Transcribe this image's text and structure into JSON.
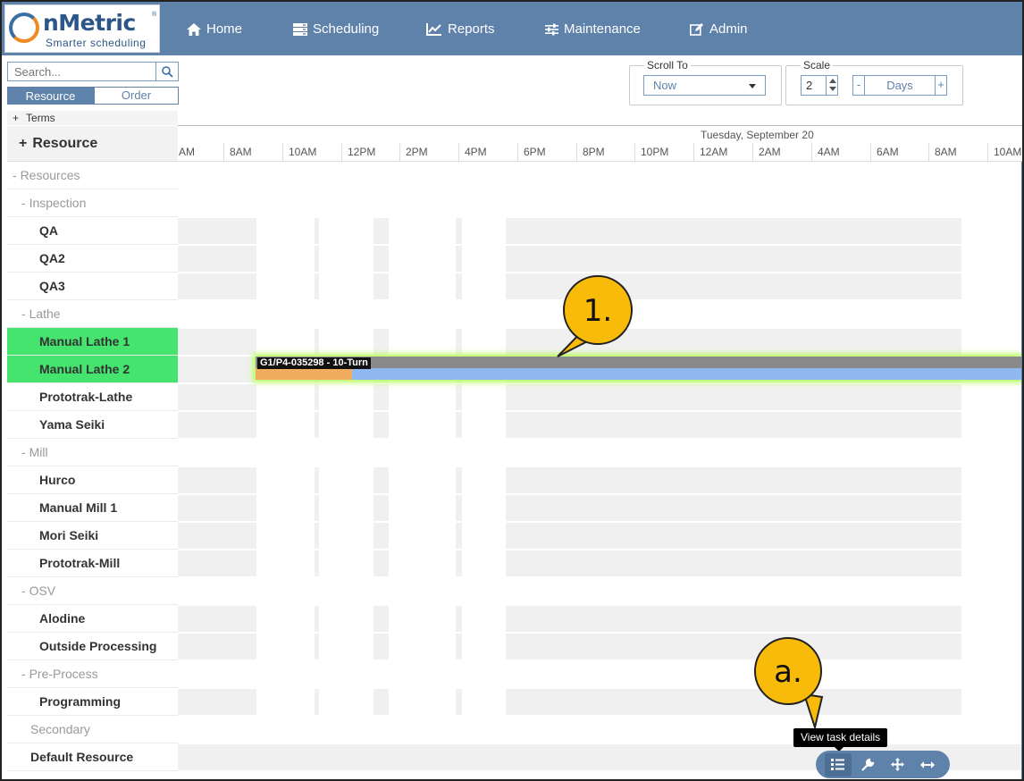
{
  "brand": {
    "name": "nMetric",
    "tagline": "Smarter scheduling",
    "registered": "®"
  },
  "nav": [
    {
      "label": "Home",
      "icon": "home-icon"
    },
    {
      "label": "Scheduling",
      "icon": "server-icon"
    },
    {
      "label": "Reports",
      "icon": "line-chart-icon"
    },
    {
      "label": "Maintenance",
      "icon": "sliders-icon"
    },
    {
      "label": "Admin",
      "icon": "edit-icon"
    }
  ],
  "search": {
    "placeholder": "Search..."
  },
  "view_tabs": {
    "resource": "Resource",
    "order": "Order",
    "active": "Resource"
  },
  "scroll_to": {
    "legend": "Scroll To",
    "value": "Now"
  },
  "scale": {
    "legend": "Scale",
    "value": "2",
    "unit": "Days",
    "minus": "-",
    "plus": "+"
  },
  "terms": "Terms",
  "resource_header": "Resource",
  "timeline": {
    "date_label": "Tuesday, September 20",
    "hours": [
      "AM",
      "8AM",
      "10AM",
      "12PM",
      "2PM",
      "4PM",
      "6PM",
      "8PM",
      "10PM",
      "12AM",
      "2AM",
      "4AM",
      "6AM",
      "8AM",
      "10AM"
    ]
  },
  "tree": [
    {
      "label": "Resources",
      "kind": "group",
      "level": 0
    },
    {
      "label": "Inspection",
      "kind": "group",
      "level": 1
    },
    {
      "label": "QA",
      "kind": "res"
    },
    {
      "label": "QA2",
      "kind": "res"
    },
    {
      "label": "QA3",
      "kind": "res"
    },
    {
      "label": "Lathe",
      "kind": "group",
      "level": 1
    },
    {
      "label": "Manual Lathe 1",
      "kind": "res",
      "highlight": true
    },
    {
      "label": "Manual Lathe 2",
      "kind": "res",
      "highlight": true
    },
    {
      "label": "Prototrak-Lathe",
      "kind": "res"
    },
    {
      "label": "Yama Seiki",
      "kind": "res"
    },
    {
      "label": "Mill",
      "kind": "group",
      "level": 1
    },
    {
      "label": "Hurco",
      "kind": "res"
    },
    {
      "label": "Manual Mill 1",
      "kind": "res"
    },
    {
      "label": "Mori Seiki",
      "kind": "res"
    },
    {
      "label": "Prototrak-Mill",
      "kind": "res"
    },
    {
      "label": "OSV",
      "kind": "group",
      "level": 1
    },
    {
      "label": "Alodine",
      "kind": "res"
    },
    {
      "label": "Outside Processing",
      "kind": "res"
    },
    {
      "label": "Pre-Process",
      "kind": "group",
      "level": 1
    },
    {
      "label": "Programming",
      "kind": "res"
    },
    {
      "label": "Secondary",
      "kind": "plain"
    },
    {
      "label": "Default Resource",
      "kind": "plainbold"
    }
  ],
  "task": {
    "label": "G1/P4-035298 - 10-Turn",
    "resource": "Manual Lathe 2",
    "progress": 0.125
  },
  "callouts": {
    "one": "1.",
    "a": "a."
  },
  "tooltip": "View task details",
  "task_toolbar": [
    {
      "icon": "list-icon",
      "name": "view-task-details-button"
    },
    {
      "icon": "wrench-icon",
      "name": "maintenance-button"
    },
    {
      "icon": "move-icon",
      "name": "move-task-button"
    },
    {
      "icon": "resize-horizontal-icon",
      "name": "resize-task-button"
    }
  ],
  "colors": {
    "header": "#5f82ab",
    "highlight": "#44e46e",
    "callout": "#f9bb0a",
    "task_progress": "#f2ac5f",
    "task_rest": "#8fb8f0"
  }
}
